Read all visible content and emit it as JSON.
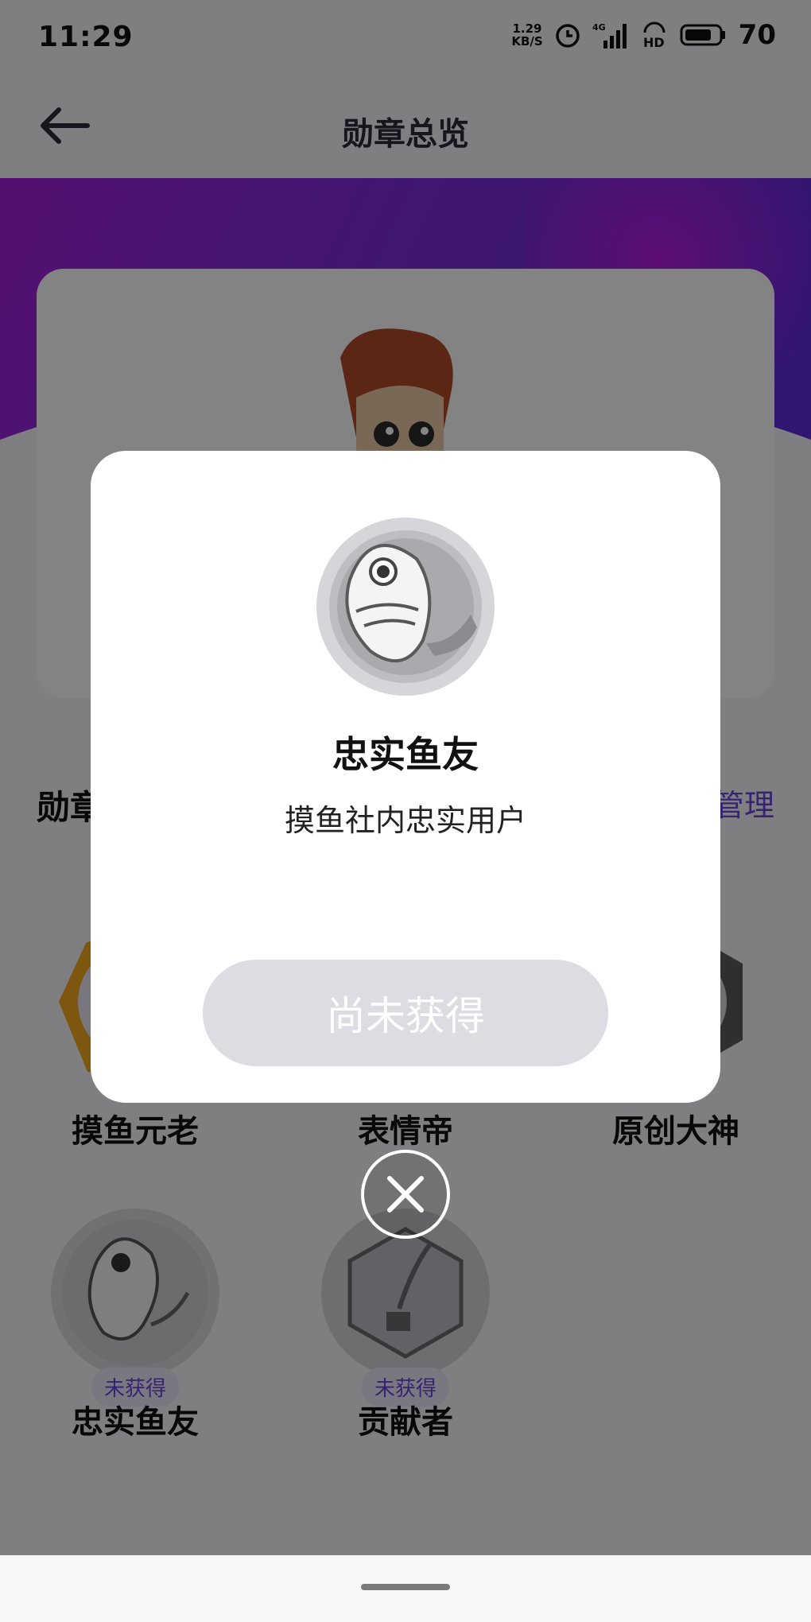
{
  "status_bar": {
    "time": "11:29",
    "net_speed_value": "1.29",
    "net_speed_unit": "KB/S",
    "network": "4G",
    "hd": "HD",
    "battery": "70",
    "icons": [
      "alarm-icon",
      "signal-icon",
      "hd-icon",
      "battery-icon"
    ]
  },
  "header": {
    "title": "勋章总览",
    "back_icon": "back-arrow-icon"
  },
  "section": {
    "title": "勋章",
    "manage_label": "管理"
  },
  "badges": [
    {
      "name": "摸鱼元老",
      "status": ""
    },
    {
      "name": "表情帝",
      "status": ""
    },
    {
      "name": "原创大神",
      "status": ""
    },
    {
      "name": "忠实鱼友",
      "status": "未获得"
    },
    {
      "name": "贡献者",
      "status": "未获得"
    }
  ],
  "dialog": {
    "badge_name": "忠实鱼友",
    "description": "摸鱼社内忠实用户",
    "action_label": "尚未获得",
    "close_icon": "close-icon"
  },
  "colors": {
    "accent": "#6a44d8",
    "banner_start": "#a21fd9",
    "banner_end": "#5a2bd8",
    "disabled_button": "#dcdce3"
  }
}
